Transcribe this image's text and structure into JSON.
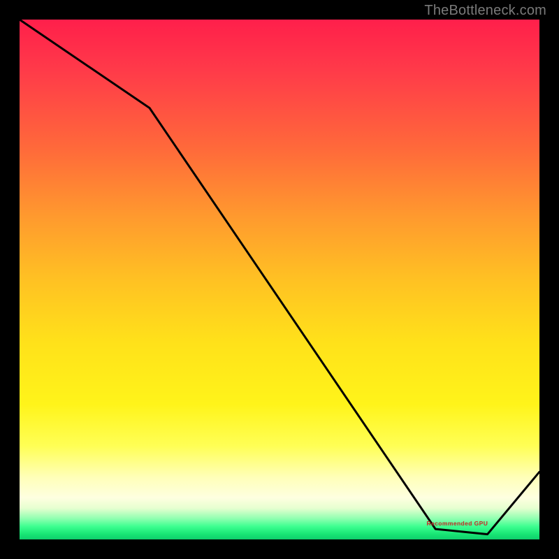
{
  "attribution": "TheBottleneck.com",
  "annotation_label": "Recommended GPU",
  "chart_data": {
    "type": "line",
    "title": "",
    "xlabel": "",
    "ylabel": "",
    "x": [
      0,
      25,
      80,
      90,
      100
    ],
    "values": [
      100,
      83,
      2,
      1,
      13
    ],
    "ylim": [
      0,
      100
    ],
    "xlim": [
      0,
      100
    ],
    "annotations": [
      {
        "text": "Recommended GPU",
        "x": 83,
        "y": 3
      }
    ],
    "background_gradient": {
      "direction": "vertical",
      "stops": [
        {
          "pos": 0.0,
          "color": "#ff1f4b"
        },
        {
          "pos": 0.5,
          "color": "#ffc123"
        },
        {
          "pos": 0.82,
          "color": "#ffff55"
        },
        {
          "pos": 0.97,
          "color": "#3dff90"
        },
        {
          "pos": 1.0,
          "color": "#0fce6c"
        }
      ]
    }
  }
}
